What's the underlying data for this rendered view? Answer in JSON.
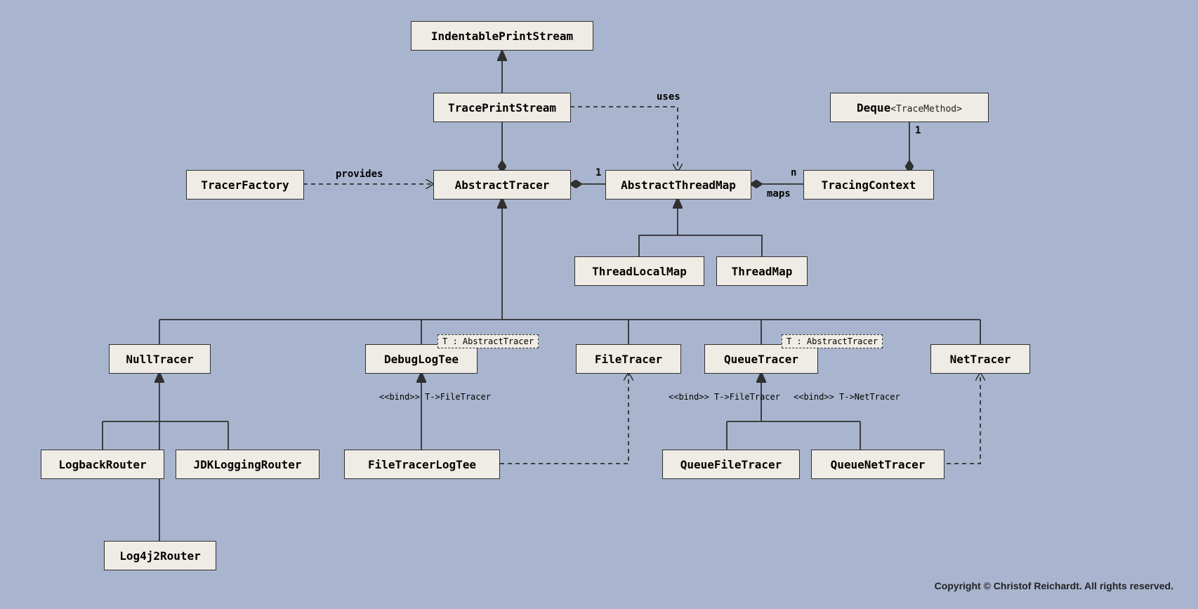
{
  "nodes": {
    "indentablePrintStream": "IndentablePrintStream",
    "tracePrintStream": "TracePrintStream",
    "deque": "Deque",
    "dequeParam": "<TraceMethod>",
    "tracerFactory": "TracerFactory",
    "abstractTracer": "AbstractTracer",
    "abstractThreadMap": "AbstractThreadMap",
    "tracingContext": "TracingContext",
    "threadLocalMap": "ThreadLocalMap",
    "threadMap": "ThreadMap",
    "nullTracer": "NullTracer",
    "debugLogTee": "DebugLogTee",
    "fileTracer": "FileTracer",
    "queueTracer": "QueueTracer",
    "netTracer": "NetTracer",
    "logbackRouter": "LogbackRouter",
    "jdkLoggingRouter": "JDKLoggingRouter",
    "fileTracerLogTee": "FileTracerLogTee",
    "queueFileTracer": "QueueFileTracer",
    "queueNetTracer": "QueueNetTracer",
    "log4j2Router": "Log4j2Router"
  },
  "templates": {
    "debugLogTee": "T : AbstractTracer",
    "queueTracer": "T : AbstractTracer"
  },
  "labels": {
    "provides": "provides",
    "uses": "uses",
    "one_a": "1",
    "one_b": "1",
    "n": "n",
    "maps": "maps",
    "bind_ft1": "<<bind>> T->FileTracer",
    "bind_ft2": "<<bind>> T->FileTracer",
    "bind_nt": "<<bind>> T->NetTracer"
  },
  "copyright": "Copyright © Christof Reichardt. All rights reserved."
}
